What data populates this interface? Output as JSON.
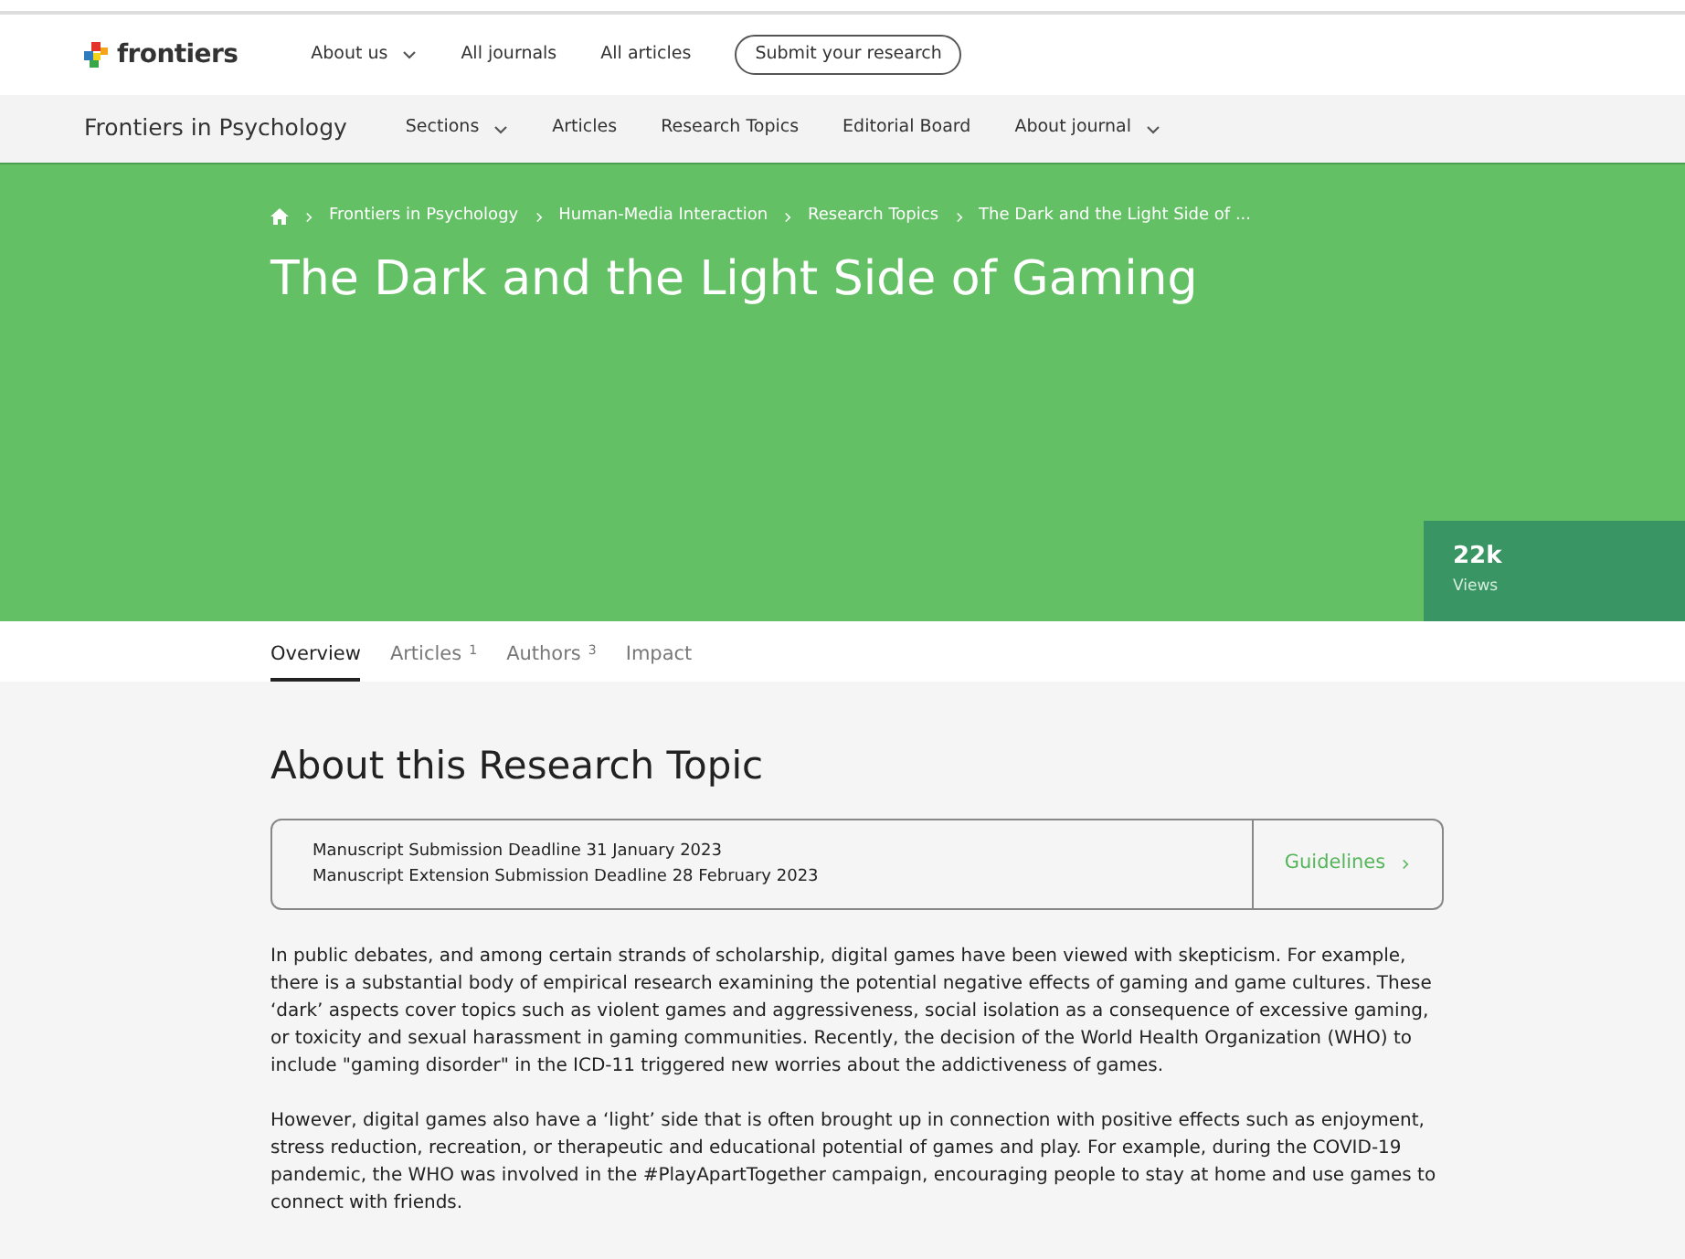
{
  "top_nav": {
    "logo": "frontiers",
    "items": [
      {
        "label": "About us",
        "dropdown": true
      },
      {
        "label": "All journals",
        "dropdown": false
      },
      {
        "label": "All articles",
        "dropdown": false
      }
    ],
    "submit_button": "Submit your research"
  },
  "journal_nav": {
    "title": "Frontiers in Psychology",
    "items": [
      {
        "label": "Sections",
        "dropdown": true
      },
      {
        "label": "Articles",
        "dropdown": false
      },
      {
        "label": "Research Topics",
        "dropdown": false
      },
      {
        "label": "Editorial Board",
        "dropdown": false
      },
      {
        "label": "About journal",
        "dropdown": true
      }
    ]
  },
  "breadcrumb": [
    "Frontiers in Psychology",
    "Human-Media Interaction",
    "Research Topics",
    "The Dark and the Light Side of ..."
  ],
  "title": "The Dark and the Light Side of Gaming",
  "views": {
    "count": "22k",
    "label": "Views"
  },
  "tabs": [
    {
      "label": "Overview",
      "selected": true
    },
    {
      "label": "Articles",
      "count": "1",
      "selected": false
    },
    {
      "label": "Authors",
      "count": "3",
      "selected": false
    },
    {
      "label": "Impact",
      "selected": false
    }
  ],
  "section_title": "About this Research Topic",
  "deadlines": [
    "Manuscript Submission Deadline 31 January 2023",
    "Manuscript Extension Submission Deadline 28 February 2023"
  ],
  "guidelines_button": "Guidelines",
  "paragraphs": [
    "In public debates, and among certain strands of scholarship, digital games have been viewed with skepticism. For example, there is a substantial body of empirical research examining the potential negative effects of gaming and game cultures. These ‘dark’ aspects cover topics such as violent games and aggressiveness, social isolation as a consequence of excessive gaming, or toxicity and sexual harassment in gaming communities. Recently, the decision of the World Health Organization (WHO) to include \"gaming disorder\" in the ICD-11 triggered new worries about the addictiveness of games.",
    "However, digital games also have a ‘light’ side that is often brought up in connection with positive effects such as enjoyment, stress reduction, recreation, or therapeutic and educational potential of games and play. For example, during the COVID-19 pandemic, the WHO was involved in the #PlayApartTogether campaign, encouraging people to stay at home and use games to connect with friends."
  ]
}
